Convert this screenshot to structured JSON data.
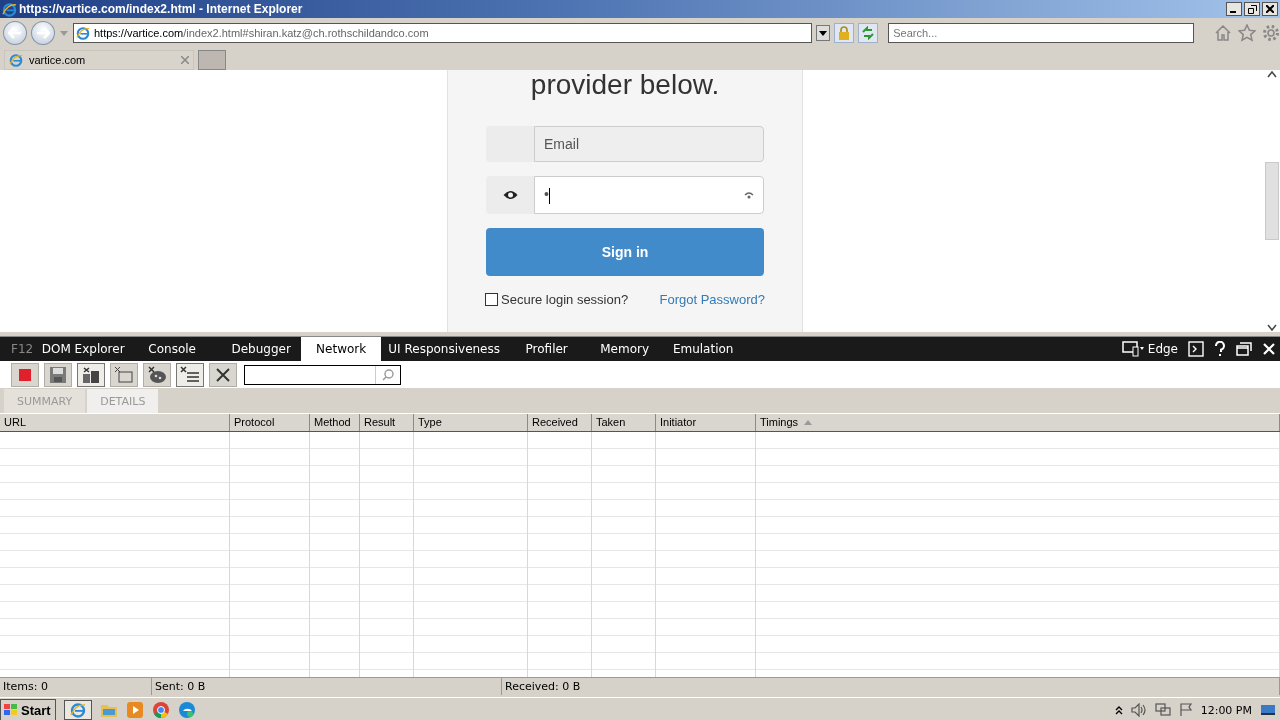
{
  "window": {
    "title": "https://vartice.com/index2.html - Internet Explorer"
  },
  "address_bar": {
    "host": "https://vartice.com",
    "path": "/index2.html#shiran.katz@ch.rothschildandco.com"
  },
  "search": {
    "placeholder": "Search..."
  },
  "browser_tabs": [
    {
      "label": "vartice.com",
      "selected": true
    }
  ],
  "page": {
    "heading": "provider below.",
    "email": {
      "placeholder": "Email"
    },
    "password": {
      "value": "•"
    },
    "sign_in": "Sign in",
    "remember": {
      "label": "Secure login session?",
      "checked": false
    },
    "forgot_link": "Forgot Password?"
  },
  "devtools": {
    "label": "F12",
    "tabs": [
      {
        "label": "DOM Explorer",
        "selected": false
      },
      {
        "label": "Console",
        "selected": false
      },
      {
        "label": "Debugger",
        "selected": false
      },
      {
        "label": "Network",
        "selected": true
      },
      {
        "label": "UI Responsiveness",
        "selected": false
      },
      {
        "label": "Profiler",
        "selected": false
      },
      {
        "label": "Memory",
        "selected": false
      },
      {
        "label": "Emulation",
        "selected": false
      }
    ],
    "mode": "Edge",
    "toolbar": [
      {
        "kind": "stop",
        "on": false
      },
      {
        "kind": "save",
        "on": false
      },
      {
        "kind": "cache",
        "on": true
      },
      {
        "kind": "clear-tab",
        "on": false
      },
      {
        "kind": "cookies",
        "on": false
      },
      {
        "kind": "list",
        "on": true
      },
      {
        "kind": "clear",
        "on": false
      }
    ],
    "subtabs": [
      {
        "label": "SUMMARY",
        "selected": false
      },
      {
        "label": "DETAILS",
        "selected": true
      }
    ],
    "columns": [
      {
        "label": "URL",
        "sorted": false
      },
      {
        "label": "Protocol",
        "sorted": false
      },
      {
        "label": "Method",
        "sorted": false
      },
      {
        "label": "Result",
        "sorted": false
      },
      {
        "label": "Type",
        "sorted": false
      },
      {
        "label": "Received",
        "sorted": false
      },
      {
        "label": "Taken",
        "sorted": false
      },
      {
        "label": "Initiator",
        "sorted": false
      },
      {
        "label": "Timings",
        "sorted": true
      }
    ],
    "status": [
      "Items: 0",
      "Sent: 0 B",
      "Received: 0 B"
    ]
  },
  "taskbar": {
    "start": "Start",
    "clock": "12:00 PM"
  }
}
